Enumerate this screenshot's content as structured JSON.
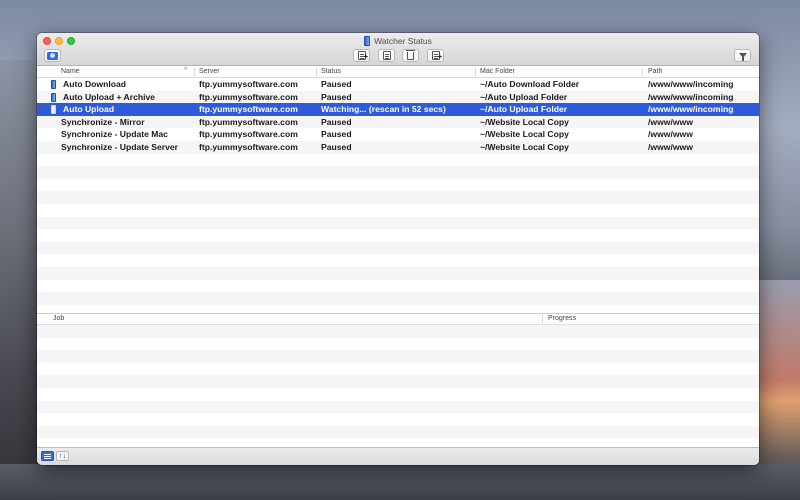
{
  "window": {
    "title": "Watcher Status"
  },
  "toolbar": {
    "left_icon": "camera-icon",
    "buttons": [
      "new-watcher-icon",
      "edit-icon",
      "trash-icon",
      "log-icon"
    ],
    "right_icon": "filter-icon"
  },
  "table": {
    "columns": [
      "Name",
      "Server",
      "Status",
      "Mac Folder",
      "Path"
    ],
    "rows": [
      {
        "name": "Auto Download",
        "server": "ftp.yummysoftware.com",
        "status": "Paused",
        "folder": "~/Auto Download Folder",
        "path": "/www/www/incoming",
        "icon": true,
        "selected": false
      },
      {
        "name": "Auto Upload + Archive",
        "server": "ftp.yummysoftware.com",
        "status": "Paused",
        "folder": "~/Auto Upload Folder",
        "path": "/www/www/incoming",
        "icon": true,
        "selected": false
      },
      {
        "name": "Auto Upload",
        "server": "ftp.yummysoftware.com",
        "status": "Watching... (rescan in 52 secs)",
        "folder": "~/Auto Upload Folder",
        "path": "/www/www/incoming",
        "icon": true,
        "selected": true
      },
      {
        "name": "Synchronize - Mirror",
        "server": "ftp.yummysoftware.com",
        "status": "Paused",
        "folder": "~/Website Local Copy",
        "path": "/www/www",
        "icon": false,
        "selected": false
      },
      {
        "name": "Synchronize - Update Mac",
        "server": "ftp.yummysoftware.com",
        "status": "Paused",
        "folder": "~/Website Local Copy",
        "path": "/www/www",
        "icon": false,
        "selected": false
      },
      {
        "name": "Synchronize - Update Server",
        "server": "ftp.yummysoftware.com",
        "status": "Paused",
        "folder": "~/Website Local Copy",
        "path": "/www/www",
        "icon": false,
        "selected": false
      }
    ]
  },
  "jobs": {
    "columns": [
      "Job",
      "Progress"
    ]
  },
  "bottombar": {
    "log_icon": "list-icon",
    "sort_label": "↑↓"
  },
  "colors": {
    "selection": "#2e5bd9",
    "flag": "#2c63d9"
  }
}
